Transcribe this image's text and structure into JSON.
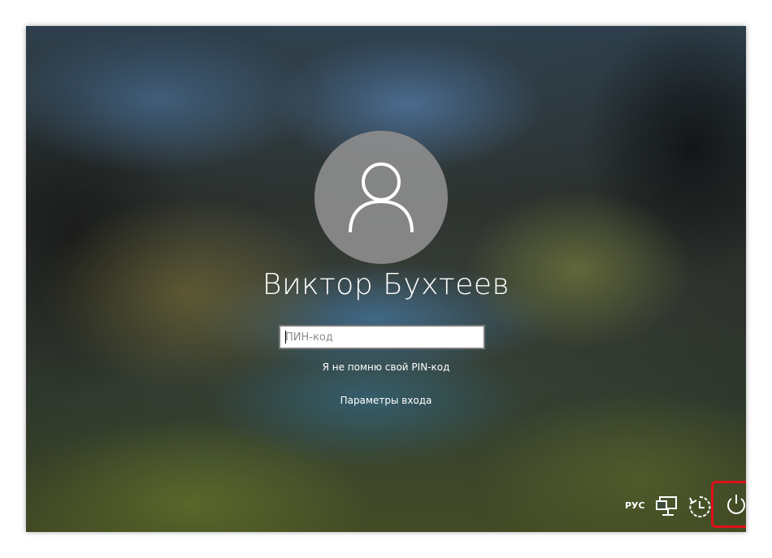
{
  "user": {
    "name": "Виктор Бухтеев"
  },
  "pin": {
    "placeholder": "ПИН-код",
    "value": ""
  },
  "links": {
    "forgot_pin": "Я не помню свой PIN-код",
    "sign_in_options": "Параметры входа"
  },
  "tray": {
    "language": "РУС",
    "icons": [
      "network-icon",
      "accessibility-icon",
      "power-icon"
    ]
  },
  "colors": {
    "highlight": "#e0101a",
    "avatar_bg": "#8c8c8c",
    "text": "#ffffff"
  }
}
